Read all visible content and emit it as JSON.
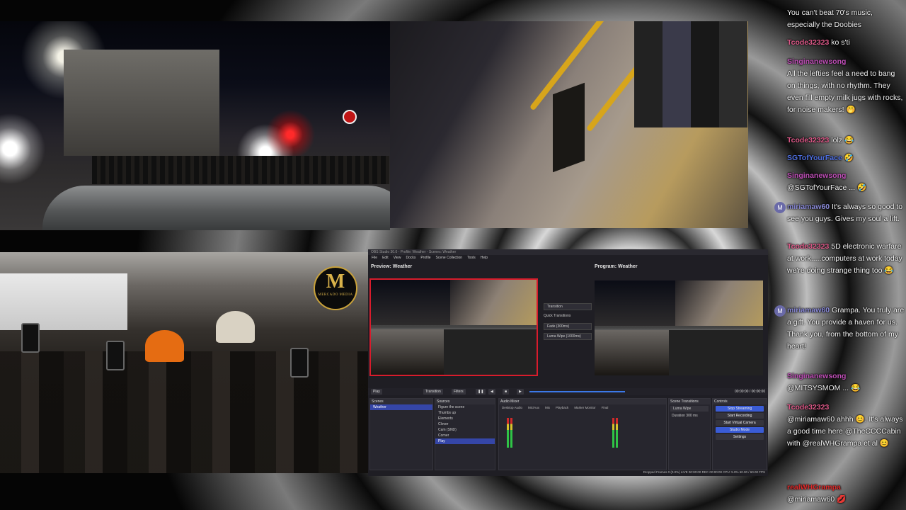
{
  "overlay": {
    "logo_initial": "M",
    "logo_text": "MERCADO MEDIA"
  },
  "obs": {
    "title": "OBS Studio 30.0 - Profile: Weather - Scenes: Weather",
    "menu": [
      "File",
      "Edit",
      "View",
      "Docks",
      "Profile",
      "Scene Collection",
      "Tools",
      "Help"
    ],
    "preview_label": "Preview: Weather",
    "program_label": "Program: Weather",
    "quick_transitions": "Quick Transitions",
    "transition_btn": "Transition",
    "fade": "Fade (300ms)",
    "luma": "Luma Wipe (1000ms)",
    "play_label": "Play",
    "transitions_btn": "Transition",
    "filters_btn": "Filters",
    "timecode": "00:00:00 / 00:00:00",
    "docks": {
      "scenes": "Scenes",
      "sources": "Sources",
      "audio_mixer": "Audio Mixer",
      "scene_transitions": "Scene Transitions",
      "controls": "Controls"
    },
    "scenes": [
      "Weather"
    ],
    "sources": [
      "Figure the scene",
      "Thumbs up",
      "Elements",
      "Clover",
      "Cam (SND)",
      "Corner",
      "Play"
    ],
    "audio_channels": [
      "Desktop Audio",
      "Mic/Aux",
      "Mix",
      "Playback",
      "Marker Monitor",
      "Final"
    ],
    "transition_select": "Luma Wipe",
    "duration_label": "Duration",
    "duration_value": "300 ms",
    "controls": [
      "Stop Streaming",
      "Start Recording",
      "Start Virtual Camera",
      "Studio Mode",
      "Settings"
    ],
    "status": "Dropped Frames 0 (0.0%)   LIVE 00:00:00   REC 00:00:00   CPU: 5.0%  60.00 / 60.00 FPS"
  },
  "chat": [
    {
      "user": "",
      "text": "You can't beat 70's music, especially the Doobies",
      "user_color": "#e8e8e8"
    },
    {
      "user": "Tcode32323",
      "text": "ko s'ti",
      "user_color": "#e05a8a"
    },
    {
      "user": "Singinanewsong",
      "text": "All the lefties feel a need to bang on things, with no rhythm. They even fill empty milk jugs with rocks, for noise makers! 🤭",
      "user_color": "#c04fb8"
    },
    {
      "user": "Tcode32323",
      "text": "lolz 😂",
      "user_color": "#e05a8a"
    },
    {
      "user": "SGTofYourFace",
      "text": "🤣",
      "user_color": "#4f6fe0"
    },
    {
      "user": "Singinanewsong",
      "text": "@SGTofYourFace ... 🤣",
      "user_color": "#c04fb8"
    },
    {
      "user": "miriamaw60",
      "text": "It's always so good to see you guys. Gives my soul a lift.",
      "user_color": "#8a8ad8"
    },
    {
      "user": "Tcode32323",
      "text": "5D electronic warfare at work.....computers at work today we're doing strange thing too 😂",
      "user_color": "#e05a8a"
    },
    {
      "user": "miriamaw60",
      "text": "Grampa. You truly are a gift. You provide a haven for us. Thank you, from the bottom of my heart!",
      "user_color": "#8a8ad8"
    },
    {
      "user": "Singinanewsong",
      "text": "@MITSYSMOM ... 😂",
      "user_color": "#c04fb8"
    },
    {
      "user": "Tcode32323",
      "text": "@miriamaw60 ahhh 😊. It's always a good time here @TheCCCCabin with @realWHGrampa et al 😊",
      "user_color": "#e05a8a"
    },
    {
      "user": "realWHGrampa",
      "text": "@miriamaw60 💋",
      "user_color": "#e02a2a"
    }
  ]
}
